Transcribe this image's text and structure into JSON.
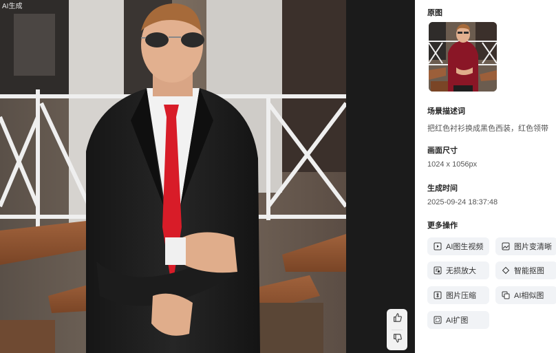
{
  "viewer": {
    "tag": "AI生成"
  },
  "panel": {
    "original_label": "原图",
    "scene_label": "场景描述词",
    "scene_text": "把红色衬衫换成黑色西装，红色领带",
    "size_label": "画面尺寸",
    "size_value": "1024 x 1056px",
    "time_label": "生成时间",
    "time_value": "2025-09-24 18:37:48",
    "more_label": "更多操作",
    "actions": [
      {
        "label": "AI图生视频",
        "icon": "image-video-icon"
      },
      {
        "label": "图片变清晰",
        "icon": "image-sharpen-icon"
      },
      {
        "label": "无损放大",
        "icon": "upscale-icon"
      },
      {
        "label": "智能抠图",
        "icon": "cutout-icon"
      },
      {
        "label": "图片压缩",
        "icon": "compress-icon"
      },
      {
        "label": "AI相似图",
        "icon": "similar-image-icon"
      },
      {
        "label": "AI扩图",
        "icon": "expand-image-icon"
      }
    ]
  },
  "feedback": {
    "like_icon": "thumbs-up-icon",
    "dislike_icon": "thumbs-down-icon"
  },
  "colors": {
    "viewer_bg": "#1b1b1b",
    "tie_red": "#d81c28",
    "suit_black": "#1e1e1e",
    "shirt_burgundy": "#8a1626",
    "button_bg": "#f1f3f6"
  }
}
